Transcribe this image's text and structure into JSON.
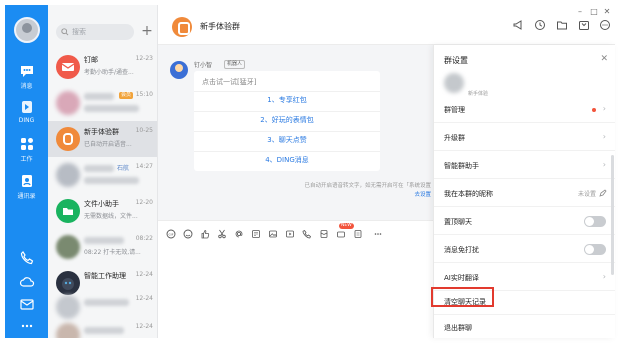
{
  "nav": {
    "items": [
      {
        "label": "消息"
      },
      {
        "label": "DING"
      },
      {
        "label": "工作"
      },
      {
        "label": "通讯录"
      }
    ]
  },
  "search": {
    "placeholder": "搜索"
  },
  "conversations": [
    {
      "name": "钉邮",
      "time": "12-23",
      "preview": "考勤小助手/通查..."
    },
    {
      "name": "",
      "time": "15:10",
      "preview": "",
      "tag": "会员"
    },
    {
      "name": "新手体验群",
      "time": "10-25",
      "preview": "已自动开启语音..."
    },
    {
      "name": "",
      "time": "14:27",
      "preview": "",
      "tag_text": "石航"
    },
    {
      "name": "文件小助手",
      "time": "12-20",
      "preview": "无需数据线，文件..."
    },
    {
      "name": "",
      "time": "08:22",
      "preview": "08:22 打卡无效,请..."
    },
    {
      "name": "智能工作助理",
      "time": "12-24",
      "preview": ""
    },
    {
      "name": "",
      "time": "12-24",
      "preview": ""
    },
    {
      "name": "",
      "time": "12-24",
      "preview": ""
    }
  ],
  "header": {
    "group_name": "新手体验群"
  },
  "chat": {
    "sender": "钉小智",
    "role": "机器人",
    "card_title": "点击试一试[猛牙]",
    "options": [
      "1、专享红包",
      "2、好玩的表情包",
      "3、聊天点赞",
      "4、DING消息"
    ],
    "system_message": "已自动开启语音转文字，如无需开启可在「系统设置",
    "system_link": "去设置"
  },
  "composer": {
    "new_badge": "NEW"
  },
  "panel": {
    "title": "群设置",
    "subname": "新手体验",
    "rows": [
      {
        "label": "群管理",
        "kind": "dot"
      },
      {
        "label": "升级群",
        "kind": "chevron"
      },
      {
        "label": "智能群助手",
        "kind": "chevron"
      },
      {
        "label": "我在本群的昵称",
        "kind": "value",
        "value": "未设置"
      },
      {
        "label": "置顶聊天",
        "kind": "toggle"
      },
      {
        "label": "消息免打扰",
        "kind": "toggle"
      },
      {
        "label": "AI实时翻译",
        "kind": "chevron"
      },
      {
        "label": "清空聊天记录",
        "kind": "plain"
      },
      {
        "label": "退出群聊",
        "kind": "plain"
      }
    ]
  },
  "colors": {
    "rail": "#1b8cf2",
    "highlight": "#e23a2e",
    "link": "#2a7ae2"
  }
}
